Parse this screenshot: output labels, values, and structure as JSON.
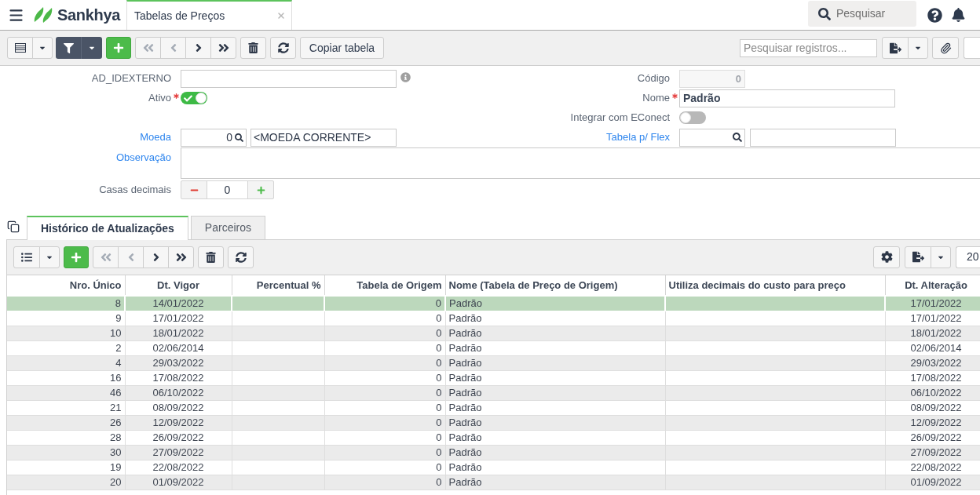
{
  "app": {
    "logo": "Sankhya"
  },
  "open_tab": {
    "title": "Tabelas de Preços"
  },
  "global_search": {
    "placeholder": "Pesquisar"
  },
  "toolbar": {
    "nav": [
      {
        "kind": "first",
        "disabled": true
      },
      {
        "kind": "previous",
        "disabled": true
      },
      {
        "kind": "next",
        "disabled": false
      },
      {
        "kind": "last",
        "disabled": false
      }
    ],
    "copy_button": "Copiar tabela",
    "search": {
      "placeholder": "Pesquisar registros..."
    }
  },
  "form": {
    "ad_idexterno": {
      "label": "AD_IDEXTERNO",
      "link": false
    },
    "ativo": {
      "label": "Ativo",
      "link": false,
      "required": true,
      "on": true
    },
    "codigo": {
      "label": "Código",
      "link": false,
      "value": "0",
      "disabled": true
    },
    "nome": {
      "label": "Nome",
      "link": false,
      "required": true,
      "value": "Padrão"
    },
    "integrar_econect": {
      "label": "Integrar com EConect",
      "link": false,
      "on": false
    },
    "moeda": {
      "label": "Moeda",
      "link": true,
      "value": "0",
      "description": "<MOEDA CORRENTE>"
    },
    "tabela_flex": {
      "label": "Tabela p/ Flex",
      "link": true
    },
    "observacao": {
      "label": "Observação",
      "link": true
    },
    "casas_decimais": {
      "label": "Casas decimais",
      "link": false,
      "value": "0"
    }
  },
  "tabs": [
    {
      "label": "Histórico de Atualizações",
      "selected": true
    },
    {
      "label": "Parceiros",
      "selected": false
    }
  ],
  "grid": {
    "toolbar": {
      "nav": [
        {
          "kind": "first",
          "disabled": true
        },
        {
          "kind": "previous",
          "disabled": true
        },
        {
          "kind": "next",
          "disabled": false
        },
        {
          "kind": "last",
          "disabled": false
        }
      ],
      "page_size": "20"
    },
    "columns": [
      "Nro. Único",
      "Dt. Vigor",
      "Percentual %",
      "Tabela de Origem",
      "Nome (Tabela de Preço de Origem)",
      "Utiliza decimais do custo para preço",
      "Dt. Alteração"
    ],
    "rows": [
      {
        "nro_unico": "8",
        "dt_vigor": "14/01/2022",
        "tabela_origem": "0",
        "nome": "Padrão",
        "dt_alteracao": "17/01/2022",
        "selected": true
      },
      {
        "nro_unico": "9",
        "dt_vigor": "17/01/2022",
        "tabela_origem": "0",
        "nome": "Padrão",
        "dt_alteracao": "17/01/2022",
        "selected": false
      },
      {
        "nro_unico": "10",
        "dt_vigor": "18/01/2022",
        "tabela_origem": "0",
        "nome": "Padrão",
        "dt_alteracao": "18/01/2022",
        "selected": false
      },
      {
        "nro_unico": "2",
        "dt_vigor": "02/06/2014",
        "tabela_origem": "0",
        "nome": "Padrão",
        "dt_alteracao": "02/06/2014",
        "selected": false
      },
      {
        "nro_unico": "4",
        "dt_vigor": "29/03/2022",
        "tabela_origem": "0",
        "nome": "Padrão",
        "dt_alteracao": "29/03/2022",
        "selected": false
      },
      {
        "nro_unico": "16",
        "dt_vigor": "17/08/2022",
        "tabela_origem": "0",
        "nome": "Padrão",
        "dt_alteracao": "17/08/2022",
        "selected": false
      },
      {
        "nro_unico": "46",
        "dt_vigor": "06/10/2022",
        "tabela_origem": "0",
        "nome": "Padrão",
        "dt_alteracao": "06/10/2022",
        "selected": false
      },
      {
        "nro_unico": "21",
        "dt_vigor": "08/09/2022",
        "tabela_origem": "0",
        "nome": "Padrão",
        "dt_alteracao": "08/09/2022",
        "selected": false
      },
      {
        "nro_unico": "26",
        "dt_vigor": "12/09/2022",
        "tabela_origem": "0",
        "nome": "Padrão",
        "dt_alteracao": "12/09/2022",
        "selected": false
      },
      {
        "nro_unico": "28",
        "dt_vigor": "26/09/2022",
        "tabela_origem": "0",
        "nome": "Padrão",
        "dt_alteracao": "26/09/2022",
        "selected": false
      },
      {
        "nro_unico": "30",
        "dt_vigor": "27/09/2022",
        "tabela_origem": "0",
        "nome": "Padrão",
        "dt_alteracao": "27/09/2022",
        "selected": false
      },
      {
        "nro_unico": "19",
        "dt_vigor": "22/08/2022",
        "tabela_origem": "0",
        "nome": "Padrão",
        "dt_alteracao": "22/08/2022",
        "selected": false
      },
      {
        "nro_unico": "20",
        "dt_vigor": "01/09/2022",
        "tabela_origem": "0",
        "nome": "Padrão",
        "dt_alteracao": "01/09/2022",
        "selected": false
      }
    ]
  }
}
